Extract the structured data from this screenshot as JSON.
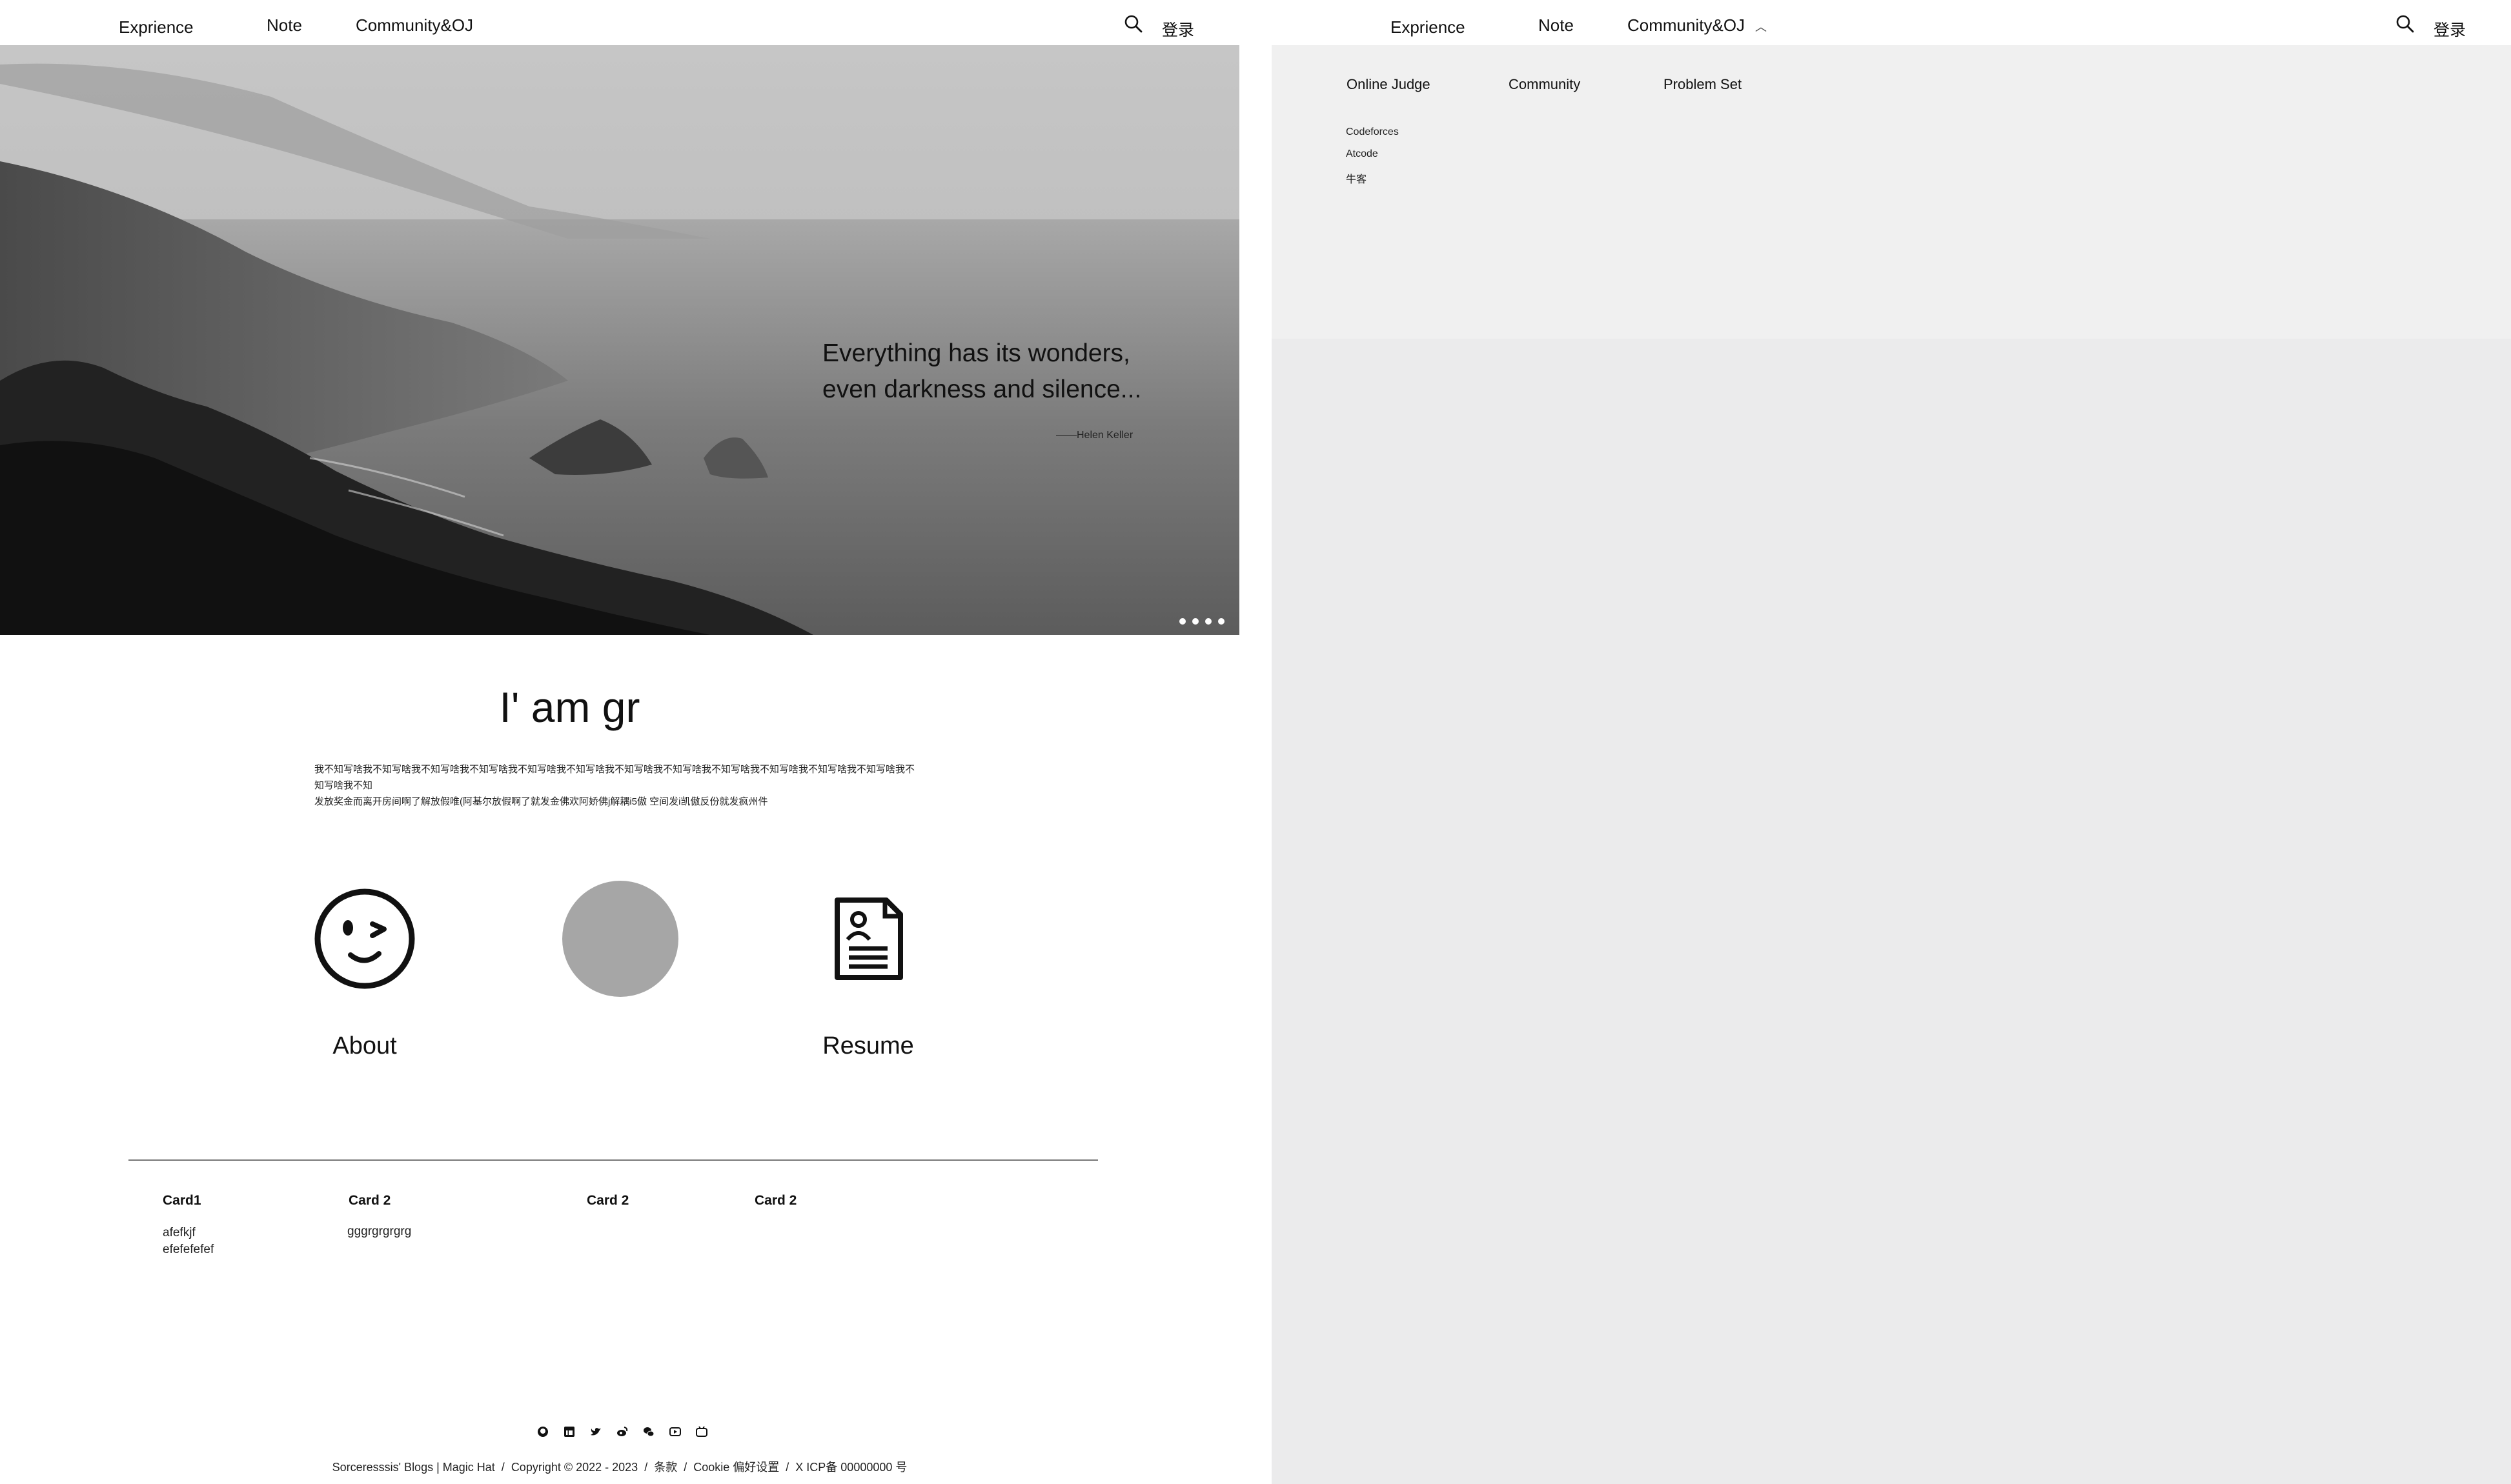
{
  "nav": {
    "brand": "Exprience",
    "note": "Note",
    "community": "Community&OJ",
    "login": "登录"
  },
  "hero": {
    "quote_line1": "Everything has its wonders,",
    "quote_line2": "even darkness and silence...",
    "author": "——Helen Keller",
    "slides": 4
  },
  "intro": {
    "title": "I' am gr",
    "text_line1": "我不知写啥我不知写啥我不知写啥我不知写啥我不知写啥我不知写啥我不知写啥我不知写啥我不知写啥我不知写啥我不知写啥我不知写啥我不知写啥我不知",
    "text_line2": "发放奖金而离开房间啊了解放假唯(阿基尔放假啊了就发金佛欢阿娇佛j解耦i5傲 空间发i凯傲反份就发疯州件"
  },
  "features": {
    "about_label": "About",
    "resume_label": "Resume"
  },
  "cards": [
    {
      "title": "Card1",
      "body": "afefkjf\nefefefefef"
    },
    {
      "title": "Card 2",
      "body": "gggrgrgrgrg"
    },
    {
      "title": "Card 2",
      "body": ""
    },
    {
      "title": "Card 2",
      "body": ""
    }
  ],
  "footer": {
    "site": "Sorceresssis' Blogs | Magic Hat",
    "copyright": "Copyright © 2022 - 2023",
    "terms": "条款",
    "cookie": "Cookie 偏好设置",
    "icp": "X ICP备 00000000 号",
    "social_icons": [
      "github-icon",
      "linkedin-icon",
      "twitter-icon",
      "weibo-icon",
      "wechat-icon",
      "youtube-icon",
      "bilibili-icon"
    ]
  },
  "dropdown": {
    "online_judge": "Online Judge",
    "community": "Community",
    "problem_set": "Problem Set",
    "oj_items": [
      "Codeforces",
      "Atcode",
      "牛客"
    ]
  },
  "colors": {
    "panel_bg": "#f0f0f0",
    "right_bg": "#ebebec",
    "divider": "#777777",
    "placeholder_circle": "#a6a6a6"
  }
}
